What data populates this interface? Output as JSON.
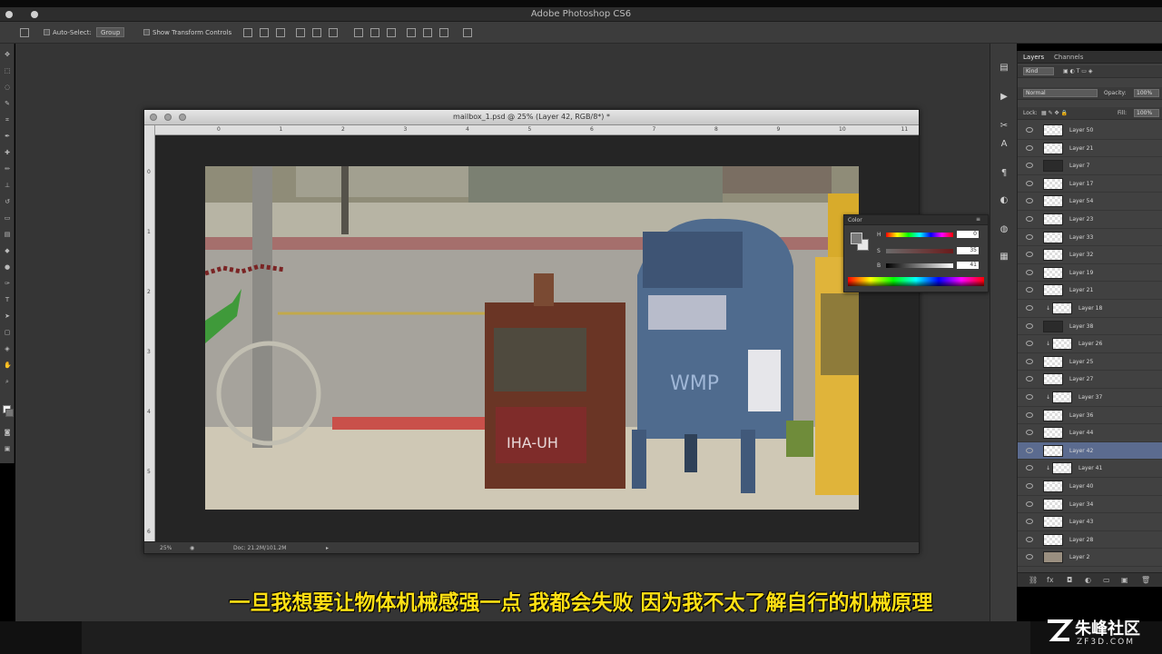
{
  "app": {
    "title": "Adobe Photoshop CS6"
  },
  "options_bar": {
    "auto_select_label": "Auto-Select:",
    "auto_select_value": "Group",
    "show_transform_label": "Show Transform Controls"
  },
  "document": {
    "title": "mailbox_1.psd @ 25% (Layer 42, RGB/8*) *",
    "zoom": "25%",
    "doc_info": "Doc: 21.2M/101.2M",
    "ruler_h": [
      "0",
      "1",
      "2",
      "3",
      "4",
      "5",
      "6",
      "7",
      "8",
      "9",
      "10",
      "11"
    ],
    "ruler_v": [
      "0",
      "1",
      "2",
      "3",
      "4",
      "5",
      "6"
    ]
  },
  "color_panel": {
    "title": "Color",
    "labels": [
      "H",
      "S",
      "B"
    ],
    "values": [
      "0",
      "35",
      "41"
    ],
    "units": [
      "°",
      "%",
      "%"
    ]
  },
  "layers_panel": {
    "tabs": [
      "Layers",
      "Channels"
    ],
    "kind_label": "Kind",
    "blend_mode": "Normal",
    "opacity_label": "Opacity:",
    "opacity_value": "100%",
    "lock_label": "Lock:",
    "fill_label": "Fill:",
    "fill_value": "100%",
    "layers": [
      {
        "name": "Layer 50",
        "thumb": "trans"
      },
      {
        "name": "Layer 21",
        "thumb": "trans"
      },
      {
        "name": "Layer 7",
        "thumb": "dark"
      },
      {
        "name": "Layer 17",
        "thumb": "trans"
      },
      {
        "name": "Layer 54",
        "thumb": "trans"
      },
      {
        "name": "Layer 23",
        "thumb": "trans"
      },
      {
        "name": "Layer 33",
        "thumb": "trans"
      },
      {
        "name": "Layer 32",
        "thumb": "trans"
      },
      {
        "name": "Layer 19",
        "thumb": "trans"
      },
      {
        "name": "Layer 21",
        "thumb": "trans"
      },
      {
        "name": "Layer 18",
        "thumb": "trans",
        "clip": true
      },
      {
        "name": "Layer 38",
        "thumb": "dark"
      },
      {
        "name": "Layer 26",
        "thumb": "trans",
        "clip": true
      },
      {
        "name": "Layer 25",
        "thumb": "trans"
      },
      {
        "name": "Layer 27",
        "thumb": "trans"
      },
      {
        "name": "Layer 37",
        "thumb": "trans",
        "clip": true
      },
      {
        "name": "Layer 36",
        "thumb": "trans"
      },
      {
        "name": "Layer 44",
        "thumb": "trans"
      },
      {
        "name": "Layer 42",
        "thumb": "trans",
        "selected": true
      },
      {
        "name": "Layer 41",
        "thumb": "trans",
        "clip": true
      },
      {
        "name": "Layer 40",
        "thumb": "trans"
      },
      {
        "name": "Layer 34",
        "thumb": "trans"
      },
      {
        "name": "Layer 43",
        "thumb": "trans"
      },
      {
        "name": "Layer 28",
        "thumb": "trans"
      },
      {
        "name": "Layer 2",
        "thumb": "photo"
      }
    ]
  },
  "subtitle": "一旦我想要让物体机械感强一点 我都会失败 因为我不太了解自行的机械原理",
  "watermark": {
    "cn": "朱峰社区",
    "en": "ZF3D.COM"
  }
}
